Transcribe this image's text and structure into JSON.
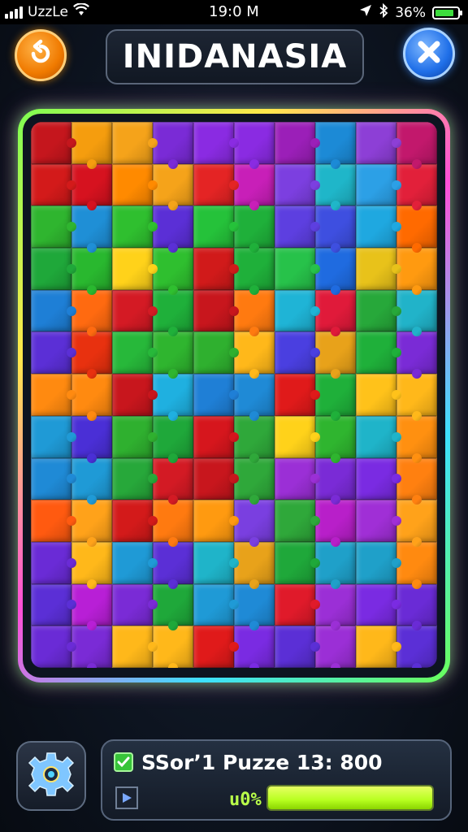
{
  "status_bar": {
    "carrier": "UzzLe",
    "time": "19:0 M",
    "battery_text": "36%",
    "battery_level": 0.85,
    "icons": [
      "signal-icon",
      "wifi-icon",
      "location-icon",
      "bluetooth-icon",
      "battery-icon"
    ]
  },
  "header": {
    "title": "INIDANASIA",
    "back_icon": "refresh-back-icon",
    "close_icon": "close-icon"
  },
  "board": {
    "columns": 10,
    "rows": 13,
    "pieces": [
      "#c5161d",
      "#f59d0e",
      "#f5a31a",
      "#7a2bd6",
      "#8a2be2",
      "#8a2be2",
      "#9b1fb8",
      "#1c8ad6",
      "#8d3fd6",
      "#c2186c",
      "#d31a1a",
      "#d6121f",
      "#ff8a00",
      "#f5a31a",
      "#e42424",
      "#c81fb8",
      "#7c3fe0",
      "#1fb6c9",
      "#2ca0e6",
      "#e2203a",
      "#2fb52f",
      "#1f8fd6",
      "#2fbf2f",
      "#5b2fd6",
      "#25c23a",
      "#1fb03a",
      "#5d3fe0",
      "#3e4fe0",
      "#1fa8e0",
      "#ff6a00",
      "#1fa83a",
      "#29b82f",
      "#ffd21a",
      "#2fbf2f",
      "#d11a1a",
      "#1fb03a",
      "#27c24a",
      "#1f6be0",
      "#e8c21a",
      "#ff9a10",
      "#1e7fd6",
      "#ff6a10",
      "#d41a24",
      "#1fb03a",
      "#c8161d",
      "#ff7a10",
      "#1fb4d6",
      "#e01a3a",
      "#27a83a",
      "#21b3c9",
      "#5b2fd6",
      "#e8310f",
      "#27b83a",
      "#2fb52f",
      "#2fb02f",
      "#ffb81a",
      "#4a3fe0",
      "#e8a21a",
      "#1fb03a",
      "#7a2bd6",
      "#ff8a10",
      "#ff8a10",
      "#c8161d",
      "#1fb0e0",
      "#1f7fd6",
      "#1f8ad6",
      "#e01a1a",
      "#1fb03a",
      "#ffc21a",
      "#ffb81a",
      "#1f9ad6",
      "#4a2fd6",
      "#2fb02f",
      "#1fa83a",
      "#d6161d",
      "#2fa83a",
      "#ffd21a",
      "#2fb52f",
      "#1fb4c9",
      "#ff9010",
      "#1f8ad6",
      "#1f9ad6",
      "#27a83a",
      "#d31a24",
      "#c8161d",
      "#2fa83a",
      "#9b2fd6",
      "#7a2bd6",
      "#7a2be2",
      "#ff8010",
      "#ff5a10",
      "#ffa21a",
      "#d31a1a",
      "#ff7a10",
      "#ff9a10",
      "#7a3fe0",
      "#2fa83a",
      "#b81fc9",
      "#a02fd6",
      "#ffa21a",
      "#6a2bd6",
      "#ffb81a",
      "#1f9ad6",
      "#5b2fd6",
      "#1fb4c9",
      "#e8a21a",
      "#1fa83a",
      "#1fa0c9",
      "#1fa0c9",
      "#ff8a10",
      "#5b2fd6",
      "#b81fd6",
      "#7a2bd6",
      "#1fa83a",
      "#1f9ad6",
      "#1f8ad6",
      "#e01a2a",
      "#9b2fd6",
      "#7a2be2",
      "#6a2bd6",
      "#6a2bd6",
      "#7a2bd6",
      "#ffb81a",
      "#ffb81a",
      "#e01a1a",
      "#7a2be2",
      "#5b2fd6",
      "#9b2fd6",
      "#ffb81a",
      "#5b2fd6"
    ]
  },
  "footer": {
    "settings_icon": "gear-icon",
    "score_label": "SSorʼ1 Puzze 13: 800",
    "progress_label": "u0%",
    "progress_level": 1.0,
    "progress_color": "#b7ff1f"
  }
}
